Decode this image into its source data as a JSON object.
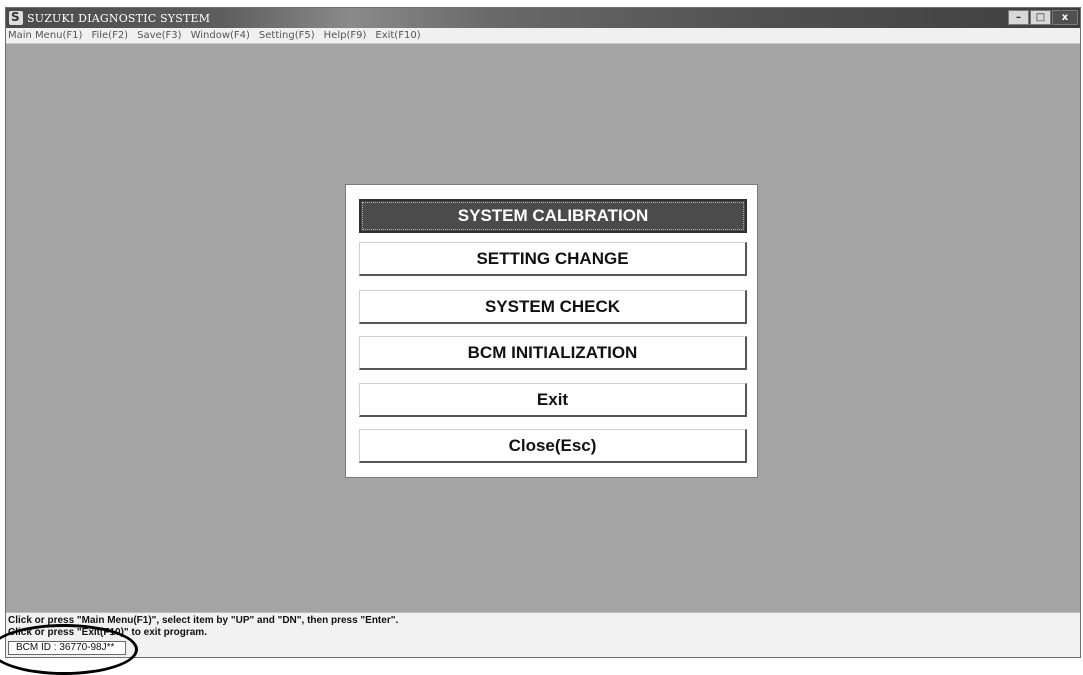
{
  "window": {
    "title": "SUZUKI DIAGNOSTIC SYSTEM",
    "controls": [
      "–",
      "□",
      "x"
    ]
  },
  "menubar": {
    "items": [
      "Main Menu(F1)",
      "File(F2)",
      "Save(F3)",
      "Window(F4)",
      "Setting(F5)",
      "Help(F9)",
      "Exit(F10)"
    ]
  },
  "main_menu": {
    "buttons": [
      "SYSTEM CALIBRATION",
      "SETTING CHANGE",
      "SYSTEM CHECK",
      "BCM INITIALIZATION",
      "Exit",
      "Close(Esc)"
    ],
    "selected": "SYSTEM CALIBRATION"
  },
  "status": {
    "line1": "Click or press \"Main Menu(F1)\", select item by \"UP\" and \"DN\", then press \"Enter\".",
    "line2": "Click or press \"Exit(F10)\" to exit program.",
    "bcm_id": "BCM ID : 36770-98J**"
  },
  "colors": {
    "background": "#a4a4a4",
    "selected_button": "#4b4b4b",
    "dialog": "#ffffff"
  }
}
